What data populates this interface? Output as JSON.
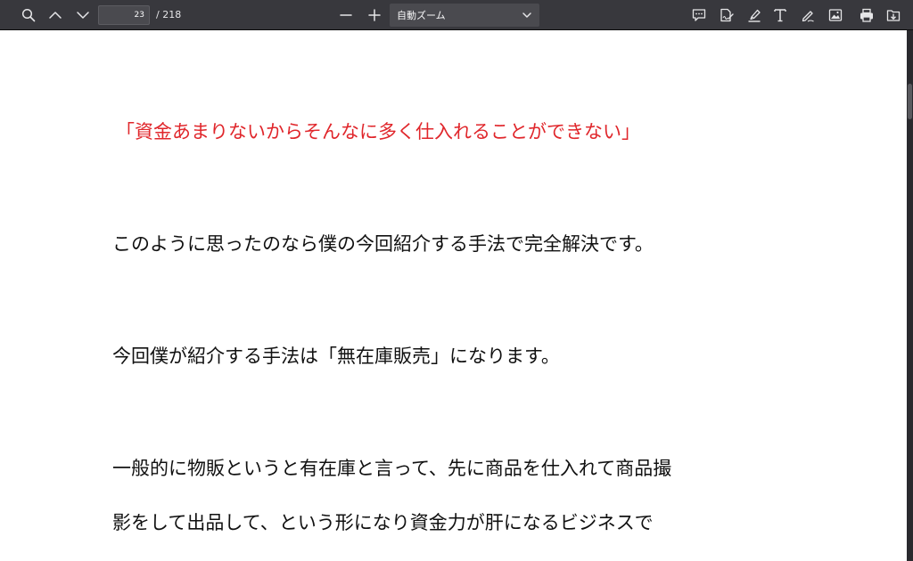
{
  "toolbar": {
    "page_number": "23",
    "page_count": "/ 218",
    "zoom_value": "自動ズーム"
  },
  "document": {
    "lines": [
      "「資金あまりないからそんなに多く仕入れることができない」",
      "このように思ったのなら僕の今回紹介する手法で完全解決です。",
      "今回僕が紹介する手法は「無在庫販売」になります。",
      "一般的に物販というと有在庫と言って、先に商品を仕入れて商品撮",
      "影をして出品して、という形になり資金力が肝になるビジネスで"
    ]
  },
  "colors": {
    "toolbar_bg": "#38383d",
    "highlight_text": "#e0262b",
    "body_text": "#111111"
  }
}
